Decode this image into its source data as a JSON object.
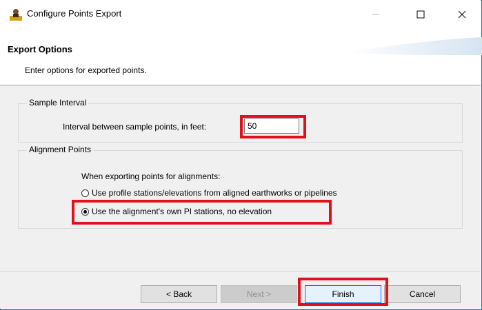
{
  "window": {
    "title": "Configure Points Export",
    "controls": {
      "minimize": "minimize-icon",
      "maximize": "maximize-icon",
      "close": "close-icon"
    }
  },
  "header": {
    "title": "Export Options",
    "subtitle": "Enter options for exported points."
  },
  "sample_interval": {
    "legend": "Sample Interval",
    "label": "Interval between sample points, in feet:",
    "value": "50"
  },
  "alignment_points": {
    "legend": "Alignment Points",
    "prompt": "When exporting points for alignments:",
    "options": [
      {
        "label": "Use profile stations/elevations from aligned earthworks or pipelines",
        "selected": false
      },
      {
        "label": "Use the alignment's own PI stations, no elevation",
        "selected": true
      }
    ]
  },
  "buttons": {
    "back": "< Back",
    "next": "Next >",
    "finish": "Finish",
    "cancel": "Cancel",
    "next_enabled": false
  },
  "colors": {
    "highlight": "#e0111b",
    "window_border": "#1c6fc9",
    "panel": "#f0f0f0"
  }
}
